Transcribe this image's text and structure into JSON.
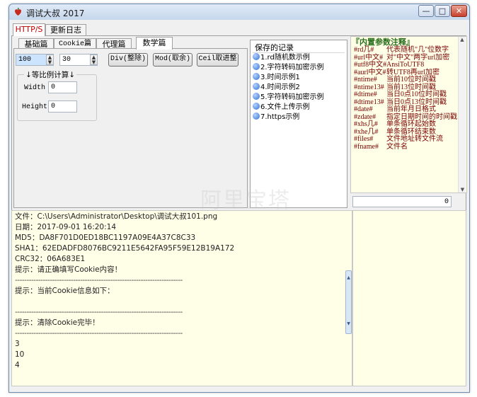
{
  "window": {
    "title": "调试大叔 2017",
    "icon": "app-logo-icon",
    "controls": {
      "minimize": "—",
      "maximize": "□",
      "close": "✕"
    }
  },
  "main_tabs": [
    "HTTP/S",
    "更新日志"
  ],
  "sub_tabs": [
    "基础篇",
    "Cookie篇",
    "代理篇",
    "数学篇"
  ],
  "math": {
    "value1": "100",
    "value2": "30",
    "buttons": [
      "Div(整除)",
      "Mod(取余)",
      "Ceil取进整"
    ],
    "ratio_group": "↓等比例计算↓",
    "width_label": "Width",
    "width_value": "0",
    "height_label": "Height",
    "height_value": "0"
  },
  "saved": {
    "title": "保存的记录",
    "items": [
      "1.rd随机数示例",
      "2.字符转码加密示例",
      "3.时间示例1",
      "4.时间示例2",
      "5.字符转码加密示例",
      "6.文件上传示例",
      "7.https示例"
    ]
  },
  "params": {
    "title": "『内置参数注释』",
    "rows": [
      {
        "key": "#rd几#",
        "desc": "代表随机\"几\"位数字"
      },
      {
        "key": "#url中文#",
        "desc": "对\"中文\"两字url加密"
      },
      {
        "key": "#utf8中文#",
        "desc": "AnsiToUTF8"
      },
      {
        "key": "#aurl中文#",
        "desc": "转UTF8再url加密"
      },
      {
        "key": "#ntime#",
        "desc": "当前10位时间戳"
      },
      {
        "key": "#ntime13#",
        "desc": "当前13位时间戳"
      },
      {
        "key": "#dtime#",
        "desc": "当日0点10位时间戳"
      },
      {
        "key": "#dtime13#",
        "desc": "当日0点13位时间戳"
      },
      {
        "key": "#date#",
        "desc": "当前年月日格式"
      },
      {
        "key": "#zdate#",
        "desc": "指定日期时间的时间戳"
      },
      {
        "key": "#xhs几#",
        "desc": "单条循环起始数"
      },
      {
        "key": "#xhe几#",
        "desc": "单条循环结束数"
      },
      {
        "key": "#files#",
        "desc": "文件地址转文件流"
      },
      {
        "key": "#fname#",
        "desc": "文件名"
      }
    ],
    "counter": "0"
  },
  "watermark": "阿里宝塔",
  "log": {
    "lines": [
      "文件：C:\\Users\\Administrator\\Desktop\\调试大叔101.png",
      "日期：2017-09-01 16:20:14",
      "MD5：DA8F701D0ED18BC1197A09E4A37C8C33",
      "SHA1：62EDADFD8076BC9211E5642FA95F59E12B19A172",
      "CRC32：06A683E1",
      "提示：请正确填写Cookie内容！",
      "------------------------------------------------------------------------",
      "提示：当前Cookie信息如下：",
      "",
      "------------------------------------------------------------------------",
      "提示：清除Cookie完毕！",
      "------------------------------------------------------------------------",
      "3",
      "10",
      "4"
    ]
  },
  "colors": {
    "log_bg": "#ffffe8",
    "param_text": "#7a0000",
    "active_tab_text": "#c00000"
  }
}
